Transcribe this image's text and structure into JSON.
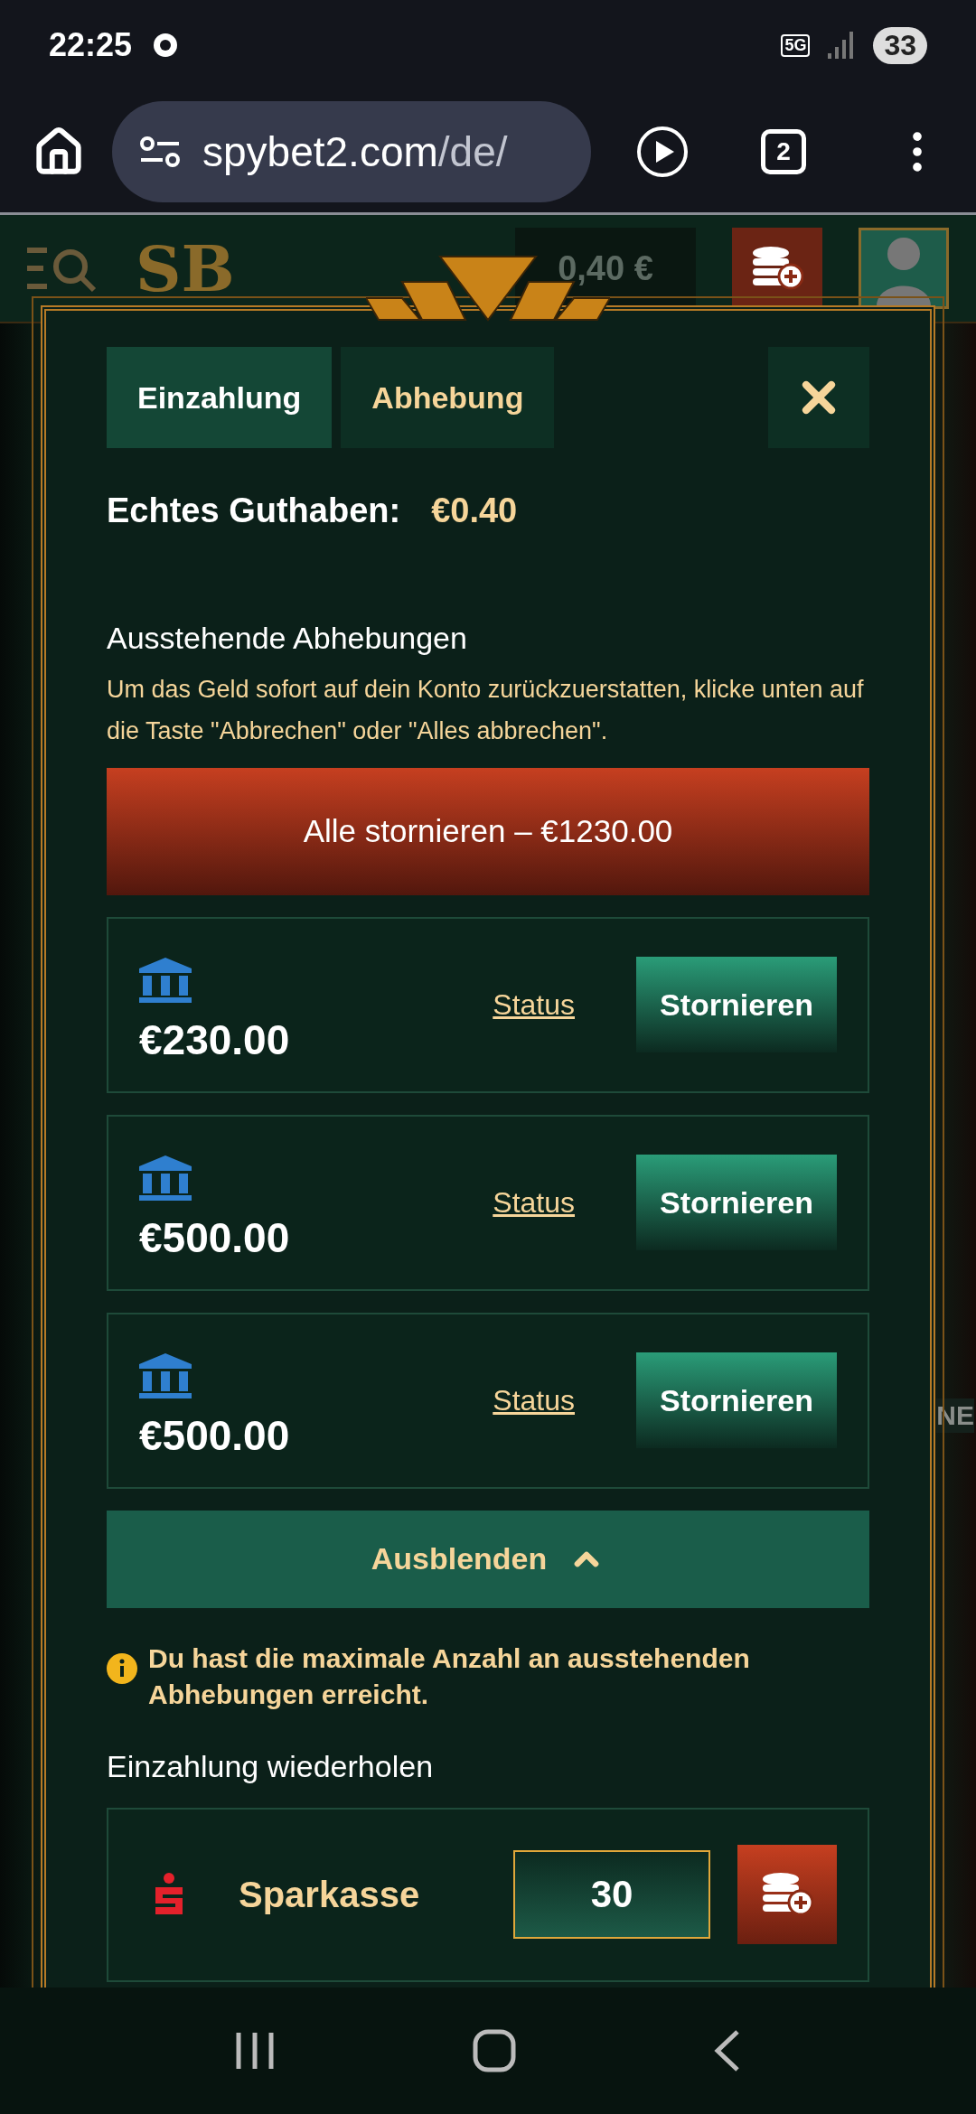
{
  "status_bar": {
    "time": "22:25",
    "network": "5G",
    "battery": "33"
  },
  "browser": {
    "url_host": "spybet2.com",
    "url_path": "/de/",
    "tab_count": "2"
  },
  "site_header": {
    "logo": "SB",
    "balance": "0,40 €"
  },
  "side_text": "NE",
  "modal": {
    "tabs": [
      {
        "label": "Einzahlung",
        "selected": true
      },
      {
        "label": "Abhebung",
        "selected": false
      }
    ],
    "balance_label": "Echtes Guthaben:",
    "balance_value": "€0.40",
    "pending": {
      "title": "Ausstehende Abhebungen",
      "description": "Um das Geld sofort auf dein Konto zurückzuerstatten, klicke unten auf die Taste \"Abbrechen\" oder \"Alles abbrechen\".",
      "cancel_all": "Alle stornieren – €1230.00",
      "items": [
        {
          "amount": "€230.00",
          "status_link": "Status",
          "cancel": "Stornieren"
        },
        {
          "amount": "€500.00",
          "status_link": "Status",
          "cancel": "Stornieren"
        },
        {
          "amount": "€500.00",
          "status_link": "Status",
          "cancel": "Stornieren"
        }
      ],
      "toggle": {
        "label": "Ausblenden",
        "expanded": true
      },
      "notice": "Du hast die maximale Anzahl an ausstehenden Abhebungen erreicht."
    },
    "repeat": {
      "title": "Einzahlung wiederholen",
      "methods": [
        {
          "name": "Sparkasse",
          "amount": "30"
        }
      ]
    }
  }
}
